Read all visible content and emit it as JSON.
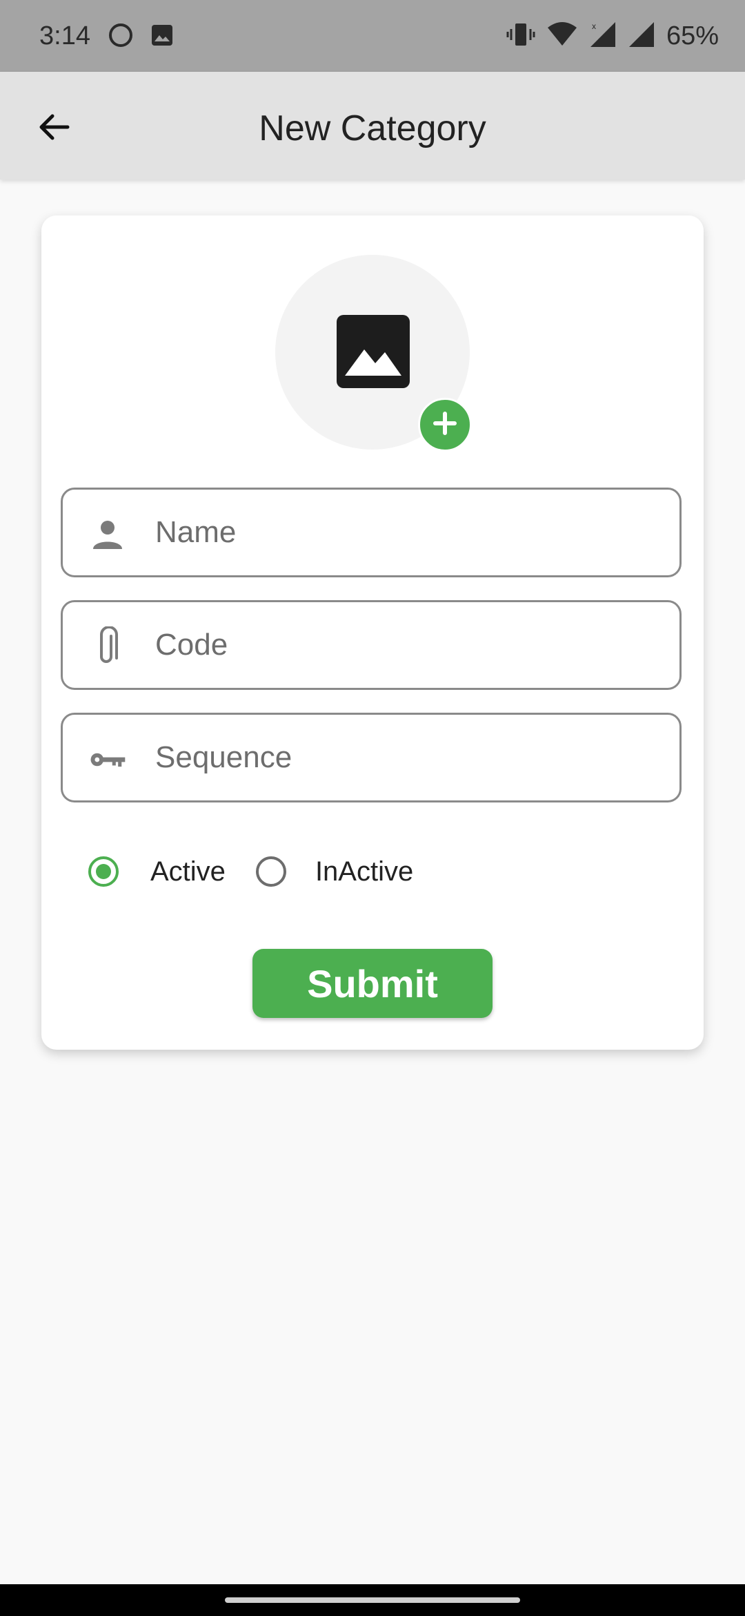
{
  "status_bar": {
    "time": "3:14",
    "battery": "65%",
    "icons": [
      "circle-icon",
      "image-icon",
      "vibrate-icon",
      "wifi-icon",
      "signal-icon",
      "signal-icon"
    ]
  },
  "app_bar": {
    "title": "New Category",
    "back_icon": "arrow-back-icon"
  },
  "form": {
    "photo": {
      "placeholder_icon": "image-icon",
      "add_icon": "plus-icon"
    },
    "name": {
      "placeholder": "Name",
      "value": "",
      "icon": "person-icon"
    },
    "code": {
      "placeholder": "Code",
      "value": "",
      "icon": "paperclip-icon"
    },
    "sequence": {
      "placeholder": "Sequence",
      "value": "",
      "icon": "key-icon"
    },
    "status": {
      "options": [
        {
          "label": "Active",
          "selected": true
        },
        {
          "label": "InActive",
          "selected": false
        }
      ]
    },
    "submit_label": "Submit"
  },
  "colors": {
    "accent": "#4caf50",
    "app_bar": "#e2e2e2",
    "status_bar": "#a4a4a4",
    "background": "#f9f9f9"
  }
}
